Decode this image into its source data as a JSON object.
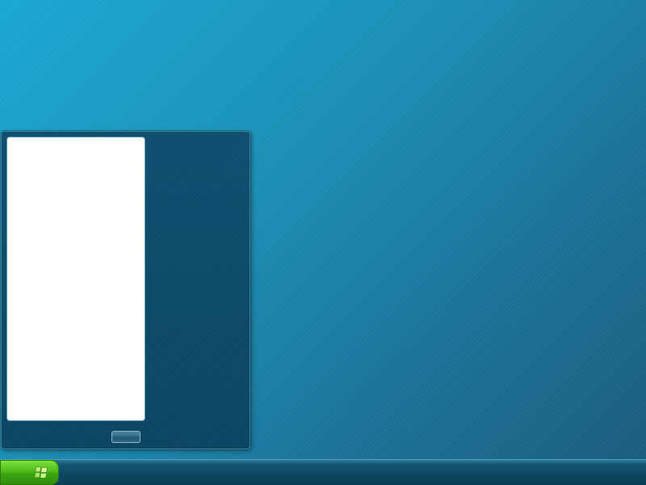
{
  "desktop": {
    "background_colors": [
      "#1aa8d2",
      "#1a5d7e"
    ]
  },
  "start_menu": {
    "programs_pane_color": "#ffffff",
    "places_pane_color": "#0e4f6d",
    "power_button": {
      "label": "",
      "icon": "power-icon"
    }
  },
  "taskbar": {
    "color": "#0d4862",
    "start_button": {
      "icon": "windows-logo-icon",
      "color": "#4fbc1b"
    }
  }
}
